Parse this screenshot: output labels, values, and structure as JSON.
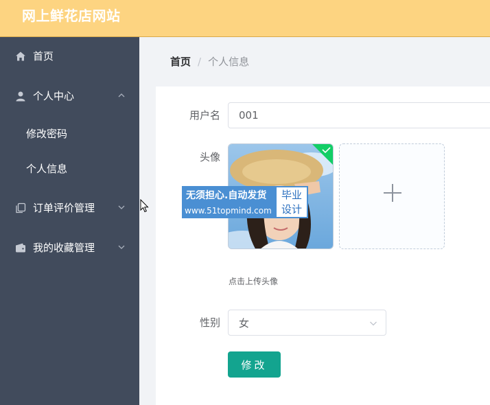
{
  "header": {
    "title": "网上鲜花店网站"
  },
  "sidebar": {
    "items": [
      {
        "label": "首页",
        "icon": "home-icon"
      },
      {
        "label": "个人中心",
        "icon": "user-icon",
        "expanded": true,
        "children": [
          {
            "label": "修改密码"
          },
          {
            "label": "个人信息"
          }
        ]
      },
      {
        "label": "订单评价管理",
        "icon": "copy-icon",
        "expanded": false
      },
      {
        "label": "我的收藏管理",
        "icon": "wallet-icon",
        "expanded": false
      }
    ]
  },
  "breadcrumb": {
    "home": "首页",
    "separator": "/",
    "current": "个人信息"
  },
  "form": {
    "username_label": "用户名",
    "username_value": "001",
    "avatar_label": "头像",
    "upload_hint": "点击上传头像",
    "gender_label": "性别",
    "gender_value": "女",
    "submit_label": "修改"
  },
  "watermark": {
    "line1": "无须担心.自动发货",
    "line2": "www.51topmind.com",
    "box_line1": "毕业",
    "box_line2": "设计"
  },
  "colors": {
    "header_bg": "#fdd481",
    "sidebar_bg": "#414b5c",
    "primary_button": "#13a48f",
    "success_badge": "#13ce66"
  }
}
